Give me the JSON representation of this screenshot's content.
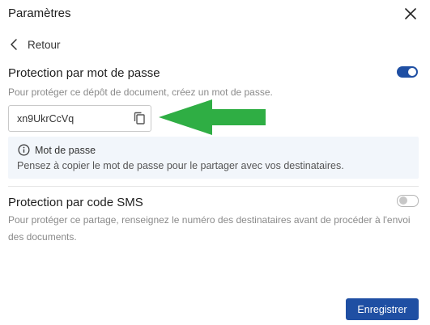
{
  "header": {
    "title": "Paramètres",
    "close_icon": "close-icon"
  },
  "nav": {
    "back_label": "Retour",
    "back_icon": "chevron-left-icon"
  },
  "password_protection": {
    "title": "Protection par mot de passe",
    "description": "Pour protéger ce dépôt de document, créez un mot de passe.",
    "enabled": true,
    "password_value": "xn9UkrCcVq",
    "copy_icon": "copy-icon",
    "info": {
      "icon": "info-icon",
      "title": "Mot de passe",
      "text": "Pensez à copier le mot de passe pour le partager avec vos destinataires."
    }
  },
  "sms_protection": {
    "title": "Protection par code SMS",
    "description_line1": "Pour protéger ce partage, renseignez le numéro des destinataires avant de procéder à l'envoi",
    "description_line2": "des documents.",
    "enabled": false
  },
  "footer": {
    "save_label": "Enregistrer"
  },
  "colors": {
    "primary": "#1f4fa3",
    "arrow": "#2fae44",
    "info_bg": "#f2f6fb",
    "muted_text": "#8a8a8a"
  }
}
